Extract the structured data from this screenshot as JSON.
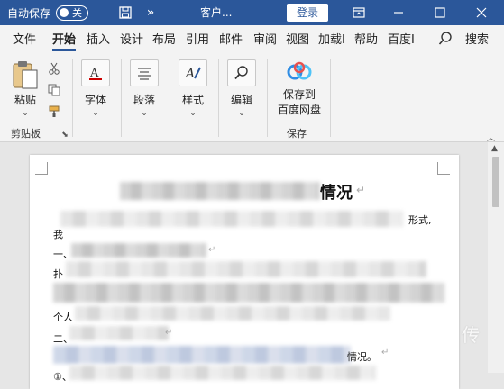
{
  "titlebar": {
    "autosave_label": "自动保存",
    "autosave_state": "关",
    "doc_title": "客户...",
    "login_label": "登录",
    "bg_color": "#2b579a"
  },
  "tabs": [
    {
      "label": "文件",
      "active": false
    },
    {
      "label": "开始",
      "active": true
    },
    {
      "label": "插入",
      "active": false
    },
    {
      "label": "设计",
      "active": false
    },
    {
      "label": "布局",
      "active": false
    },
    {
      "label": "引用",
      "active": false
    },
    {
      "label": "邮件",
      "active": false
    },
    {
      "label": "审阅",
      "active": false
    },
    {
      "label": "视图",
      "active": false
    },
    {
      "label": "加载I",
      "active": false
    },
    {
      "label": "帮助",
      "active": false
    },
    {
      "label": "百度Ⅰ",
      "active": false
    }
  ],
  "search_label": "搜索",
  "ribbon": {
    "paste_label": "粘贴",
    "clipboard_group": "剪贴板",
    "font_label": "字体",
    "paragraph_label": "段落",
    "styles_label": "样式",
    "edit_label": "编辑",
    "save_baidu_line1": "保存到",
    "save_baidu_line2": "百度网盘",
    "save_group": "保存"
  },
  "document": {
    "heading_visible": "情况",
    "snippets": {
      "s1": "形式,",
      "s2": "我",
      "s3": "一、",
      "s4": "扑",
      "s5": "个人",
      "s6": "二、",
      "s7": "情况。",
      "s8": "①、"
    }
  },
  "watermark": "传"
}
